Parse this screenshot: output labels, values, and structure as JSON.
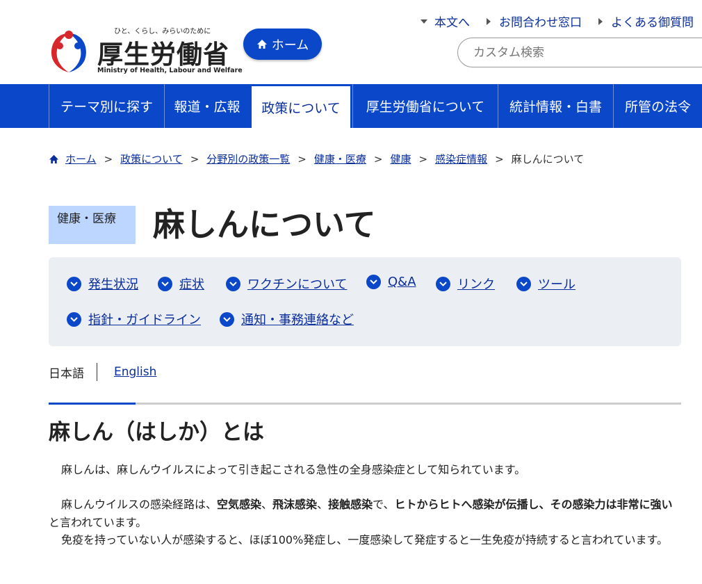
{
  "header": {
    "logo": {
      "tagline": "ひと、くらし、みらいのために",
      "name": "厚生労働省",
      "english": "Ministry of Health, Labour and Welfare"
    },
    "home_button": "ホーム",
    "utility_links": [
      "本文へ",
      "お問合わせ窓口",
      "よくある御質問"
    ],
    "search_placeholder": "カスタム検索"
  },
  "nav": {
    "items": [
      "テーマ別に探す",
      "報道・広報",
      "政策について",
      "厚生労働省について",
      "統計情報・白書",
      "所管の法令"
    ],
    "active": "政策について"
  },
  "breadcrumb": {
    "items": [
      "ホーム",
      "政策について",
      "分野別の政策一覧",
      "健康・医療",
      "健康",
      "感染症情報"
    ],
    "current": "麻しんについて"
  },
  "page": {
    "category": "健康・医療",
    "title": "麻しんについて"
  },
  "anchors": [
    "発生状況",
    "症状",
    "ワクチンについて",
    "Q&A",
    "リンク",
    "ツール",
    "指針・ガイドライン",
    "通知・事務連絡など"
  ],
  "language": {
    "current": "日本語",
    "alt": "English"
  },
  "section": {
    "heading": "麻しん（はしか）とは",
    "p1": "麻しんは、麻しんウイルスによって引き起こされる急性の全身感染症として知られています。",
    "p2_a": "麻しんウイルスの感染経路は、",
    "p2_b1": "空気感染",
    "p2_sep1": "、",
    "p2_b2": "飛沫感染",
    "p2_sep2": "、",
    "p2_b3": "接触感染",
    "p2_c": "で、",
    "p2_b4": "ヒトからヒトへ感染が伝播し、その感染力は非常に強い",
    "p2_d": "と言われています。",
    "p3": "免疫を持っていない人が感染すると、ほぼ100%発症し、一度感染して発症すると一生免疫が持続すると言われています。"
  },
  "colors": {
    "brand_blue": "#0a47c9",
    "link": "#0a2e9c",
    "badge": "#bcd6ff",
    "panel": "#ebeef3"
  },
  "icons": [
    "logo-mark-icon",
    "home-icon",
    "chevron-down-icon",
    "caret-right-icon",
    "arrow-down-circle-icon"
  ]
}
